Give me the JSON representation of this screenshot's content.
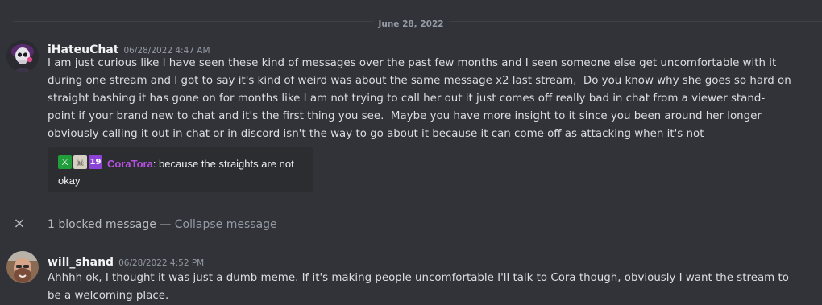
{
  "date_divider": "June 28, 2022",
  "messages": [
    {
      "username": "iHateuChat",
      "timestamp": "06/28/2022 4:47 AM",
      "content": "I am just curious like I have seen these kind of messages over the past few months and I seen someone else get uncomfortable with it\nduring one stream and I got to say it's kind of weird was about the same message x2 last stream,  Do you know why she goes so hard on\nstraight bashing it has gone on for months like I am not trying to call her out it just comes off really bad in chat from a viewer stand-\npoint if your brand new to chat and it's the first thing you see.  Maybe you have more insight to it since you been around her longer\nobviously calling it out in chat or in discord isn't the way to go about it because it can come off as attacking when it's not",
      "embed": {
        "badges": [
          {
            "icon": "sword-badge-icon",
            "glyph": "⚔",
            "color": "#1f9e3a"
          },
          {
            "icon": "skull-badge-icon",
            "glyph": "☠",
            "color": "#d6d0c2"
          },
          {
            "icon": "subscriber-badge-icon",
            "glyph": "19",
            "color": "#8b44d6"
          }
        ],
        "chat_username": "CoraTora",
        "chat_message": ": because the straights are not okay"
      }
    },
    {
      "username": "will_shand",
      "timestamp": "06/28/2022 4:52 PM",
      "content": "Ahhhh ok, I thought it was just a dumb meme. If it's making people uncomfortable I'll talk to Cora though, obviously I want the stream to\nbe a welcoming place."
    }
  ],
  "blocked": {
    "close_icon": "×",
    "text": "1 blocked message",
    "separator": " — ",
    "collapse_label": "Collapse message"
  },
  "colors": {
    "background": "#313338",
    "text": "#dbdee1",
    "username": "#f2f3f5",
    "muted": "#949ba4",
    "chat_username": "#b550e0"
  }
}
